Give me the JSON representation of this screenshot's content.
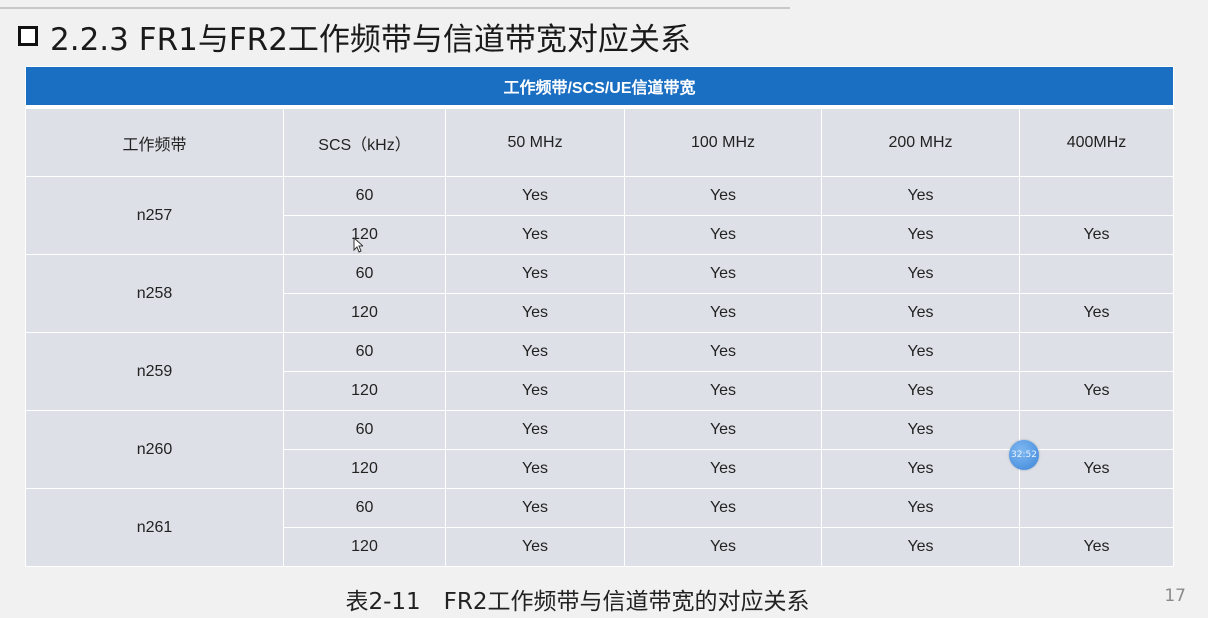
{
  "slide": {
    "title": "2.2.3 FR1与FR2工作频带与信道带宽对应关系",
    "caption": "表2-11　FR2工作频带与信道带宽的对应关系",
    "page_number": "17",
    "timer_badge": "32:52"
  },
  "table": {
    "banner": "工作频带/SCS/UE信道带宽",
    "headers": [
      "工作频带",
      "SCS（kHz）",
      "50 MHz",
      "100 MHz",
      "200 MHz",
      "400MHz"
    ],
    "bands": [
      {
        "band": "n257",
        "rows": [
          {
            "scs": "60",
            "c50": "Yes",
            "c100": "Yes",
            "c200": "Yes",
            "c400": ""
          },
          {
            "scs": "120",
            "c50": "Yes",
            "c100": "Yes",
            "c200": "Yes",
            "c400": "Yes"
          }
        ]
      },
      {
        "band": "n258",
        "rows": [
          {
            "scs": "60",
            "c50": "Yes",
            "c100": "Yes",
            "c200": "Yes",
            "c400": ""
          },
          {
            "scs": "120",
            "c50": "Yes",
            "c100": "Yes",
            "c200": "Yes",
            "c400": "Yes"
          }
        ]
      },
      {
        "band": "n259",
        "rows": [
          {
            "scs": "60",
            "c50": "Yes",
            "c100": "Yes",
            "c200": "Yes",
            "c400": ""
          },
          {
            "scs": "120",
            "c50": "Yes",
            "c100": "Yes",
            "c200": "Yes",
            "c400": "Yes"
          }
        ]
      },
      {
        "band": "n260",
        "rows": [
          {
            "scs": "60",
            "c50": "Yes",
            "c100": "Yes",
            "c200": "Yes",
            "c400": ""
          },
          {
            "scs": "120",
            "c50": "Yes",
            "c100": "Yes",
            "c200": "Yes",
            "c400": "Yes"
          }
        ]
      },
      {
        "band": "n261",
        "rows": [
          {
            "scs": "60",
            "c50": "Yes",
            "c100": "Yes",
            "c200": "Yes",
            "c400": ""
          },
          {
            "scs": "120",
            "c50": "Yes",
            "c100": "Yes",
            "c200": "Yes",
            "c400": "Yes"
          }
        ]
      }
    ]
  },
  "colors": {
    "banner": "#1b6fc2",
    "cell": "#dde1e7",
    "background": "#f1f1f1"
  }
}
